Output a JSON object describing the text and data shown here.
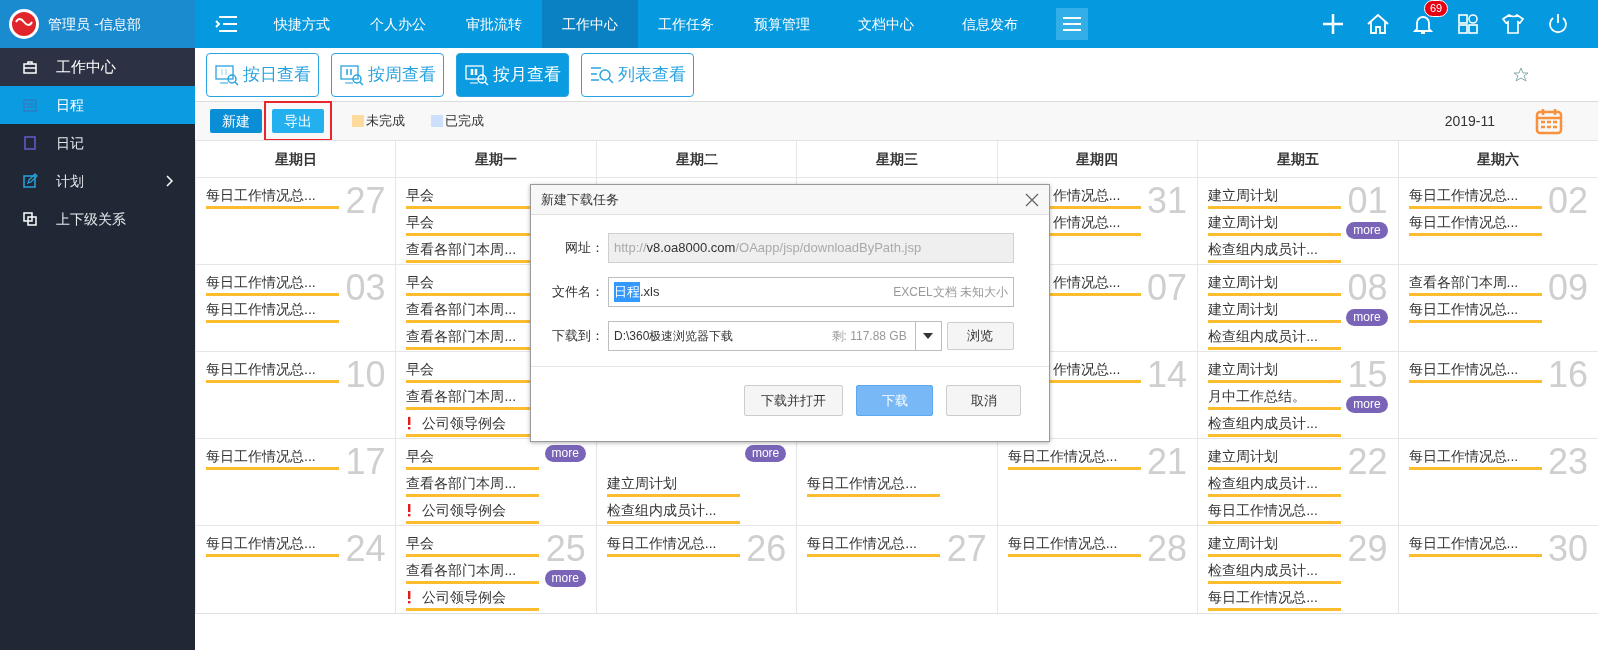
{
  "sidebar": {
    "user": "管理员 -信息部",
    "items": [
      {
        "label": "工作中心",
        "kind": "section",
        "selected": false,
        "submenu": false
      },
      {
        "label": "日程",
        "kind": "entry",
        "selected": true,
        "submenu": false
      },
      {
        "label": "日记",
        "kind": "entry",
        "selected": false,
        "submenu": false
      },
      {
        "label": "计划",
        "kind": "entry",
        "selected": false,
        "submenu": true
      },
      {
        "label": "上下级关系",
        "kind": "entry",
        "selected": false,
        "submenu": false
      }
    ]
  },
  "top_nav": {
    "tabs": [
      {
        "label": "快捷方式",
        "selected": false
      },
      {
        "label": "个人办公",
        "selected": false
      },
      {
        "label": "审批流转",
        "selected": false
      },
      {
        "label": "工作中心",
        "selected": true
      },
      {
        "label": "工作任务",
        "selected": false
      },
      {
        "label": "预算管理",
        "selected": false
      },
      {
        "label": "文档中心",
        "selected": false
      },
      {
        "label": "信息发布",
        "selected": false
      }
    ],
    "notification_count": "69"
  },
  "view_buttons": [
    {
      "label": "按日查看",
      "selected": false
    },
    {
      "label": "按周查看",
      "selected": false
    },
    {
      "label": "按月查看",
      "selected": true
    },
    {
      "label": "列表查看",
      "selected": false
    }
  ],
  "toolbar": {
    "buttons": [
      {
        "label": "新建",
        "highlighted": false,
        "kind": "primary"
      },
      {
        "label": "导出",
        "highlighted": true,
        "kind": "light"
      }
    ],
    "legend": [
      {
        "label": "未完成",
        "color": "#fddb9c"
      },
      {
        "label": "已完成",
        "color": "#cce0fb"
      }
    ],
    "month": "2019-11"
  },
  "calendar": {
    "weekdays": [
      "星期日",
      "星期一",
      "星期二",
      "星期三",
      "星期四",
      "星期五",
      "星期六"
    ],
    "weeks": [
      {
        "left": [
          {
            "date": "27",
            "items": [
              {
                "text": "每日工作情况总..."
              }
            ]
          },
          {
            "items": [
              {
                "text": "早会"
              },
              {
                "text": "早会"
              },
              {
                "text": "查看各部门本周..."
              }
            ]
          }
        ],
        "right": [
          {
            "date": "31",
            "items": [
              {
                "text": "作情况总...",
                "covered": true
              },
              {
                "text": "作情况总...",
                "covered": true
              }
            ]
          },
          {
            "date": "01",
            "more": "more",
            "items": [
              {
                "text": "建立周计划"
              },
              {
                "text": "建立周计划"
              },
              {
                "text": "检查组内成员计..."
              }
            ]
          },
          {
            "date": "02",
            "items": [
              {
                "text": "每日工作情况总..."
              },
              {
                "text": "每日工作情况总..."
              }
            ]
          }
        ]
      },
      {
        "left": [
          {
            "date": "03",
            "items": [
              {
                "text": "每日工作情况总..."
              },
              {
                "text": "每日工作情况总..."
              }
            ]
          },
          {
            "items": [
              {
                "text": "早会"
              },
              {
                "text": "查看各部门本周..."
              },
              {
                "text": "查看各部门本周..."
              }
            ]
          }
        ],
        "right": [
          {
            "date": "07",
            "items": [
              {
                "text": "作情况总...",
                "covered": true
              }
            ]
          },
          {
            "date": "08",
            "more": "more",
            "items": [
              {
                "text": "建立周计划"
              },
              {
                "text": "建立周计划"
              },
              {
                "text": "检查组内成员计..."
              }
            ]
          },
          {
            "date": "09",
            "items": [
              {
                "text": "查看各部门本周..."
              },
              {
                "text": "每日工作情况总..."
              }
            ]
          }
        ]
      },
      {
        "left": [
          {
            "date": "10",
            "items": [
              {
                "text": "每日工作情况总..."
              }
            ]
          },
          {
            "items": [
              {
                "text": "早会"
              },
              {
                "text": "查看各部门本周..."
              },
              {
                "text": "公司领导例会",
                "urgent": true
              }
            ]
          }
        ],
        "right": [
          {
            "date": "14",
            "items": [
              {
                "text": "作情况总...",
                "covered": true
              }
            ]
          },
          {
            "date": "15",
            "more": "more",
            "items": [
              {
                "text": "建立周计划"
              },
              {
                "text": "月中工作总结。"
              },
              {
                "text": "检查组内成员计..."
              }
            ]
          },
          {
            "date": "16",
            "items": [
              {
                "text": "每日工作情况总..."
              }
            ]
          }
        ]
      },
      {
        "cells": [
          {
            "date": "17",
            "items": [
              {
                "text": "每日工作情况总..."
              }
            ]
          },
          {
            "more": "more",
            "items": [
              {
                "text": "早会"
              },
              {
                "text": "查看各部门本周..."
              },
              {
                "text": "公司领导例会",
                "urgent": true
              }
            ]
          },
          {
            "more": "more",
            "first_slot_covered": true,
            "items": [
              {
                "text": "建立周计划"
              },
              {
                "text": "检查组内成员计..."
              }
            ]
          },
          {
            "first_slot_covered": true,
            "items": [
              {
                "text": "每日工作情况总..."
              }
            ]
          },
          {
            "date": "21",
            "items": [
              {
                "text": "每日工作情况总..."
              }
            ]
          },
          {
            "date": "22",
            "items": [
              {
                "text": "建立周计划"
              },
              {
                "text": "检查组内成员计..."
              },
              {
                "text": "每日工作情况总..."
              }
            ]
          },
          {
            "date": "23",
            "items": [
              {
                "text": "每日工作情况总..."
              }
            ]
          }
        ]
      },
      {
        "cells": [
          {
            "date": "24",
            "items": [
              {
                "text": "每日工作情况总..."
              }
            ]
          },
          {
            "date": "25",
            "more": "more",
            "items": [
              {
                "text": "早会"
              },
              {
                "text": "查看各部门本周..."
              },
              {
                "text": "公司领导例会",
                "urgent": true
              }
            ]
          },
          {
            "date": "26",
            "items": [
              {
                "text": "每日工作情况总..."
              }
            ]
          },
          {
            "date": "27",
            "items": [
              {
                "text": "每日工作情况总..."
              }
            ]
          },
          {
            "date": "28",
            "items": [
              {
                "text": "每日工作情况总..."
              }
            ]
          },
          {
            "date": "29",
            "items": [
              {
                "text": "建立周计划"
              },
              {
                "text": "检查组内成员计..."
              },
              {
                "text": "每日工作情况总..."
              }
            ]
          },
          {
            "date": "30",
            "items": [
              {
                "text": "每日工作情况总..."
              }
            ]
          }
        ]
      }
    ]
  },
  "dialog": {
    "title": "新建下载任务",
    "url_label": "网址：",
    "url": [
      {
        "text": "http://",
        "emphasis": false
      },
      {
        "text": "v8.oa8000.com",
        "emphasis": true
      },
      {
        "text": "/OAapp/jsp/downloadByPath.jsp",
        "emphasis": false
      }
    ],
    "filename_label": "文件名：",
    "filename_selected": "日程",
    "filename_rest": ".xls",
    "file_info": "EXCEL文档 未知大小",
    "path_label": "下载到：",
    "path": "D:\\360极速浏览器下载",
    "free_space": "剩: 117.88 GB",
    "browse": "浏览",
    "buttons": [
      {
        "label": "下载并打开",
        "kind": "default"
      },
      {
        "label": "下载",
        "kind": "primary"
      },
      {
        "label": "取消",
        "kind": "default"
      }
    ]
  }
}
